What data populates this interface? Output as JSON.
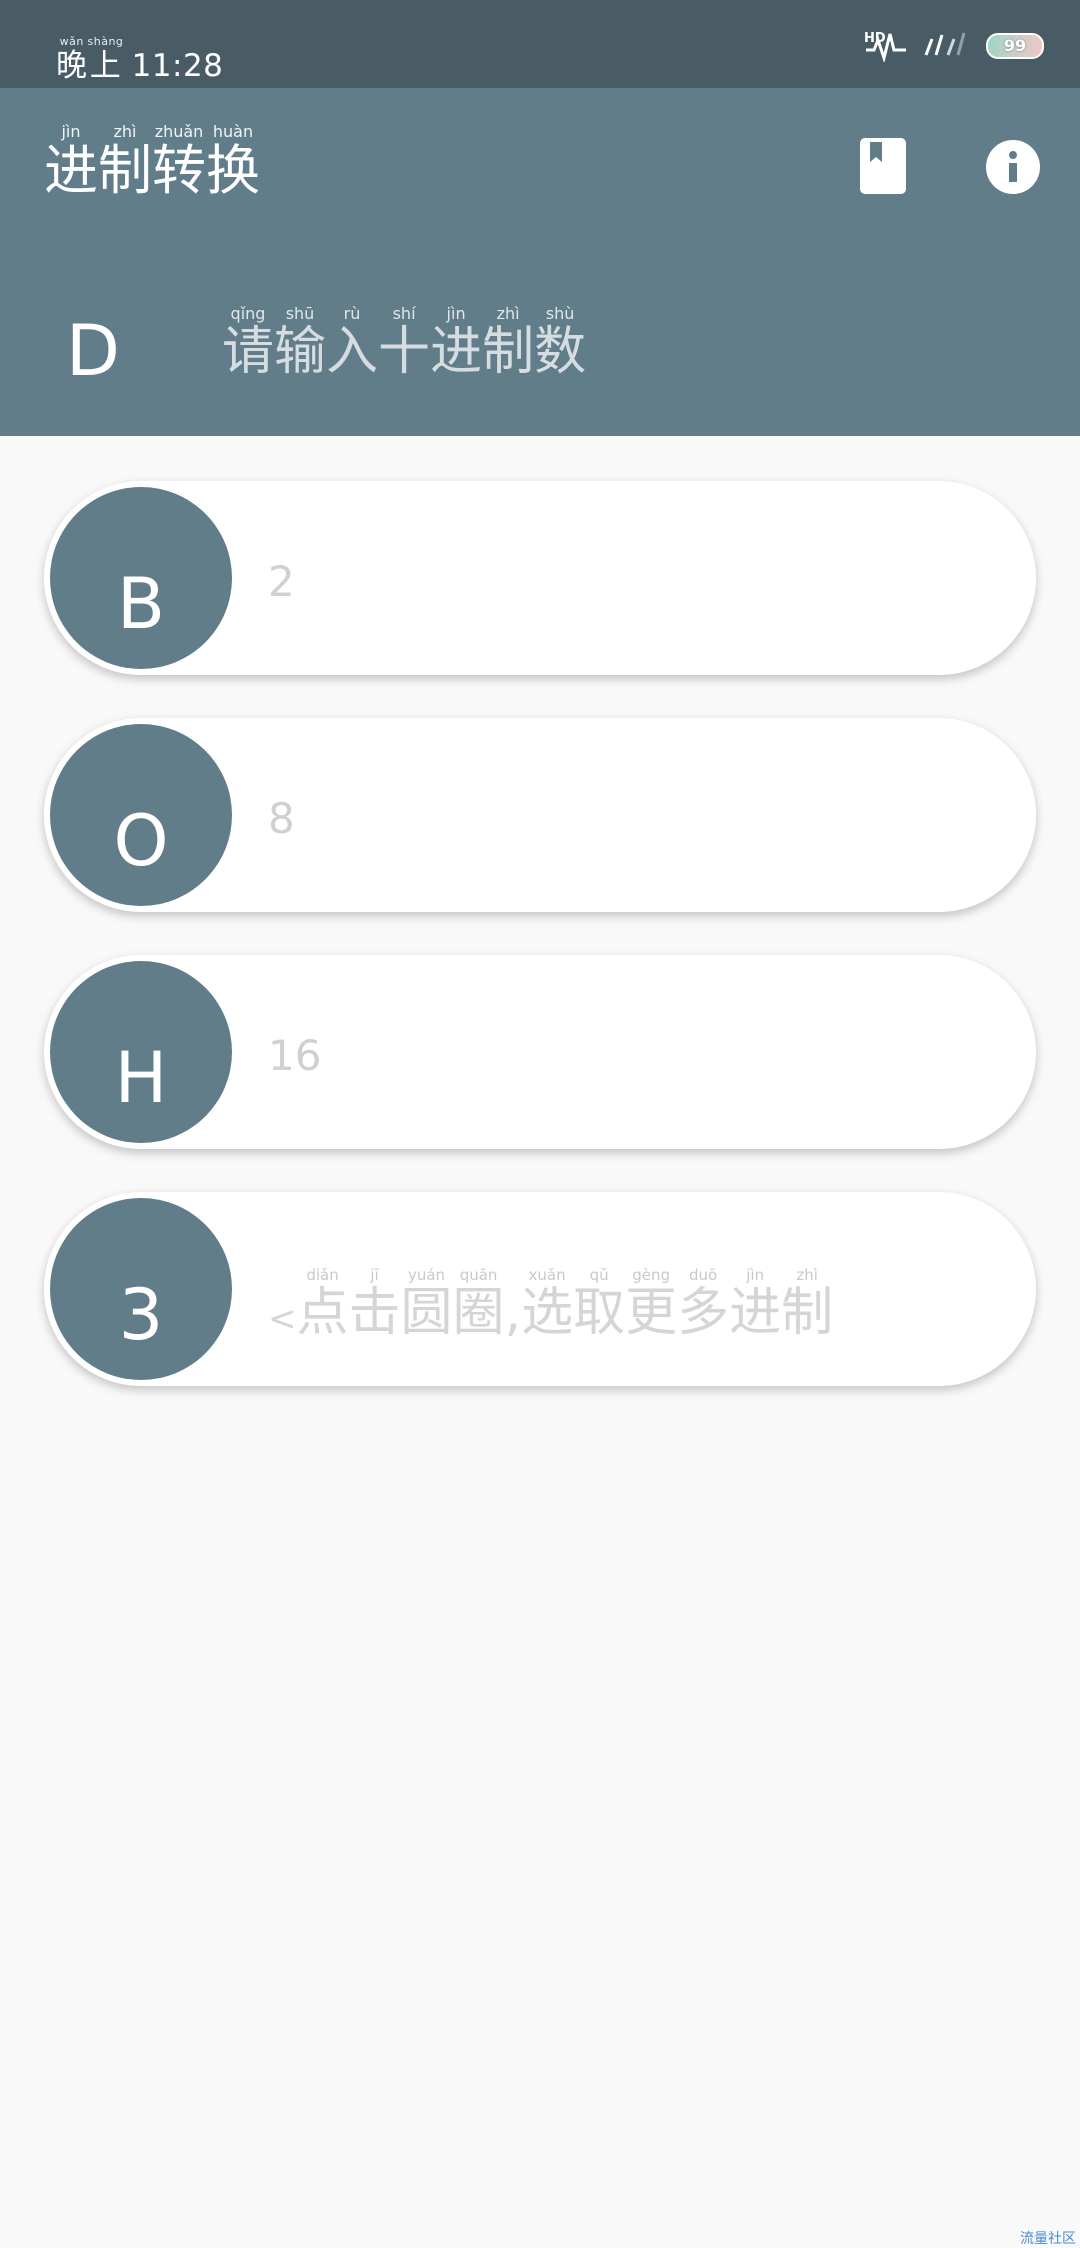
{
  "status_bar": {
    "time": "11:28",
    "period": [
      {
        "char": "晚",
        "pinyin": "wǎn"
      },
      {
        "char": "上",
        "pinyin": "shàng"
      }
    ],
    "network_label": "HD",
    "battery": "99"
  },
  "app_bar": {
    "title": [
      {
        "char": "进",
        "pinyin": "jìn"
      },
      {
        "char": "制",
        "pinyin": "zhì"
      },
      {
        "char": "转",
        "pinyin": "zhuǎn"
      },
      {
        "char": "换",
        "pinyin": "huàn"
      }
    ],
    "bookmark_icon": "bookmark-icon",
    "info_icon": "info-icon",
    "main_input": {
      "label": "D",
      "value": "",
      "placeholder": [
        {
          "char": "请",
          "pinyin": "qǐng"
        },
        {
          "char": "输",
          "pinyin": "shū"
        },
        {
          "char": "入",
          "pinyin": "rù"
        },
        {
          "char": "十",
          "pinyin": "shí"
        },
        {
          "char": "进",
          "pinyin": "jìn"
        },
        {
          "char": "制",
          "pinyin": "zhì"
        },
        {
          "char": "数",
          "pinyin": "shù"
        }
      ]
    }
  },
  "rows": [
    {
      "label": "B",
      "placeholder": "2",
      "value": ""
    },
    {
      "label": "O",
      "placeholder": "8",
      "value": ""
    },
    {
      "label": "H",
      "placeholder": "16",
      "value": ""
    },
    {
      "label": "3",
      "hint_prefix": "<",
      "hint": [
        {
          "char": "点",
          "pinyin": "diǎn"
        },
        {
          "char": "击",
          "pinyin": "jī"
        },
        {
          "char": "圆",
          "pinyin": "yuán"
        },
        {
          "char": "圈",
          "pinyin": "quān"
        },
        {
          "char": ",",
          "pinyin": ""
        },
        {
          "char": "选",
          "pinyin": "xuǎn"
        },
        {
          "char": "取",
          "pinyin": "qǔ"
        },
        {
          "char": "更",
          "pinyin": "gèng"
        },
        {
          "char": "多",
          "pinyin": "duō"
        },
        {
          "char": "进",
          "pinyin": "jìn"
        },
        {
          "char": "制",
          "pinyin": "zhì"
        }
      ]
    }
  ],
  "watermark": "流量社区",
  "colors": {
    "status_bar": "#495c66",
    "app_bar": "#627d8a",
    "circle": "#627d8a",
    "background": "#f9f9f9",
    "placeholder_text": "#d0d0d0"
  }
}
